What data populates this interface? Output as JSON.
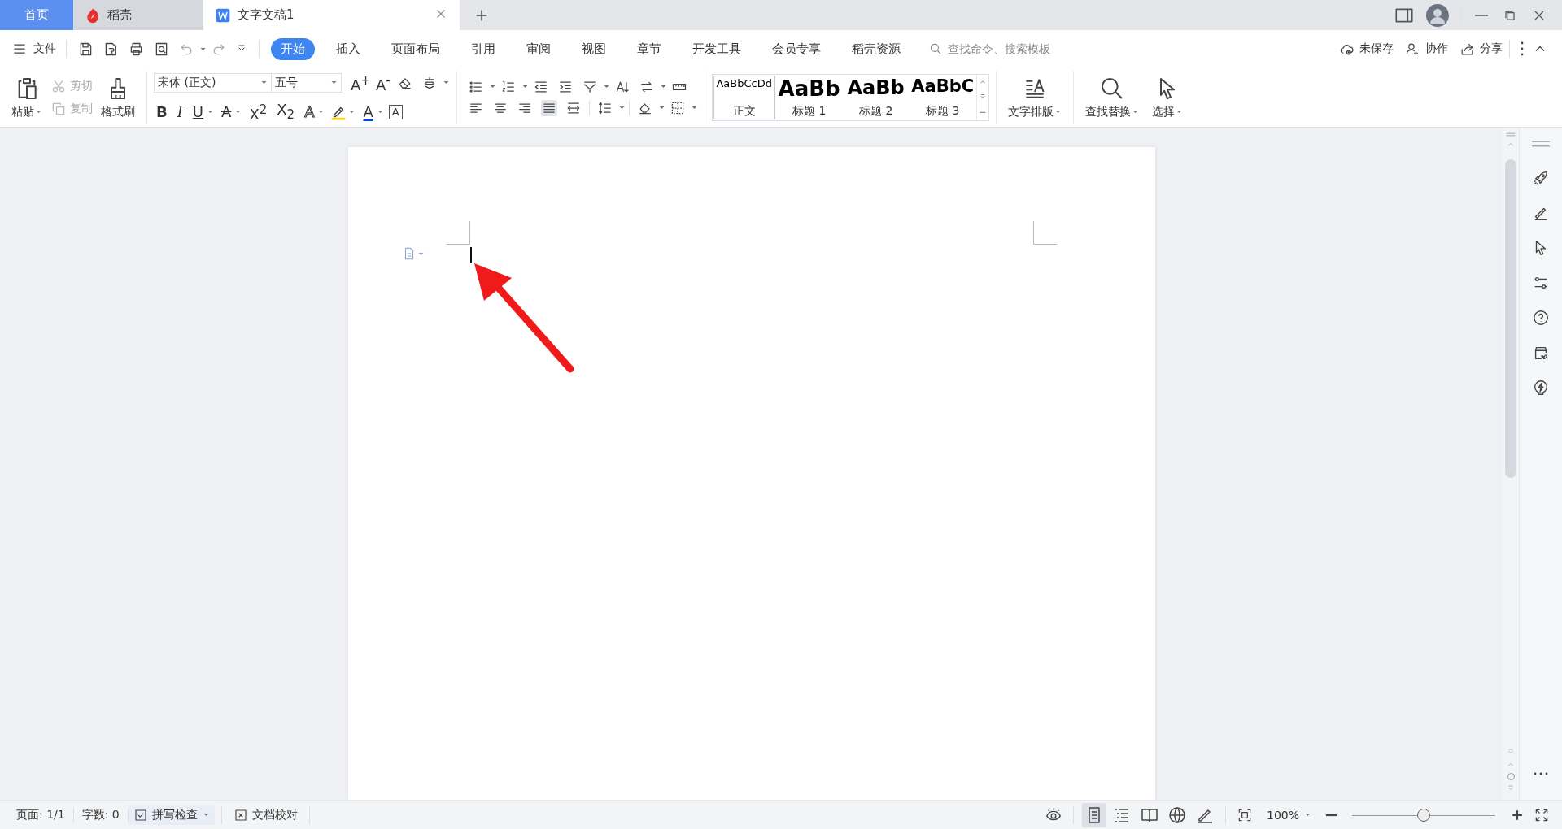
{
  "tabs": [
    {
      "kind": "home",
      "label": "首页",
      "selected": false
    },
    {
      "kind": "docer",
      "label": "稻壳",
      "selected": false
    },
    {
      "kind": "document",
      "label": "文字文稿1",
      "selected": true
    }
  ],
  "menu": {
    "file": "文件",
    "ribbon_tabs": [
      {
        "label": "开始",
        "selected": true
      },
      {
        "label": "插入",
        "selected": false
      },
      {
        "label": "页面布局",
        "selected": false
      },
      {
        "label": "引用",
        "selected": false
      },
      {
        "label": "审阅",
        "selected": false
      },
      {
        "label": "视图",
        "selected": false
      },
      {
        "label": "章节",
        "selected": false
      },
      {
        "label": "开发工具",
        "selected": false
      },
      {
        "label": "会员专享",
        "selected": false
      },
      {
        "label": "稻壳资源",
        "selected": false
      }
    ],
    "search": {
      "placeholder": "查找命令、搜索模板"
    },
    "actions": [
      {
        "kind": "save-status",
        "label": "未保存"
      },
      {
        "kind": "collaborate",
        "label": "协作"
      },
      {
        "kind": "share",
        "label": "分享"
      }
    ]
  },
  "ribbon": {
    "paste": "粘贴",
    "cut": {
      "label": "剪切",
      "disabled": true
    },
    "copy": {
      "label": "复制",
      "disabled": true
    },
    "format_painter": "格式刷",
    "font_family": "宋体 (正文)",
    "font_size": "五号",
    "grow": "A$^{+}$",
    "shrink": "A$^{-}$",
    "format_buttons": [
      {
        "kind": "bold",
        "label": "B"
      },
      {
        "kind": "italic",
        "label": "I"
      },
      {
        "kind": "underline",
        "label": "U"
      },
      {
        "kind": "strike",
        "label": "A"
      },
      {
        "kind": "superscript",
        "label": "X$^{2}$"
      },
      {
        "kind": "subscript",
        "label": "X$_{2}$"
      },
      {
        "kind": "effect",
        "label": "A"
      },
      {
        "kind": "highlight"
      },
      {
        "kind": "color",
        "label": "A"
      },
      {
        "kind": "border",
        "label": "A"
      }
    ],
    "styles": [
      {
        "preview": "AaBbCcDd",
        "label": "正文",
        "selected": true
      },
      {
        "preview": "AaBb",
        "label": "标题 1",
        "selected": false
      },
      {
        "preview": "AaBb",
        "label": "标题 2",
        "selected": false
      },
      {
        "preview": "AaBbC",
        "label": "标题 3",
        "selected": false
      }
    ],
    "text_layout": "文字排版",
    "find_replace": "查找替换",
    "select": "选择"
  },
  "status_bar": {
    "page": "页面: 1/1",
    "words": "字数: 0",
    "spell_check": "拼写检查",
    "proofread": "文档校对",
    "view_modes": [
      {
        "kind": "page",
        "selected": true
      },
      {
        "kind": "outline",
        "selected": false
      },
      {
        "kind": "read",
        "selected": false
      },
      {
        "kind": "web",
        "selected": false
      },
      {
        "kind": "write",
        "selected": false
      }
    ],
    "zoom": "100%",
    "zoom_slider": {
      "level": 0.5
    }
  }
}
